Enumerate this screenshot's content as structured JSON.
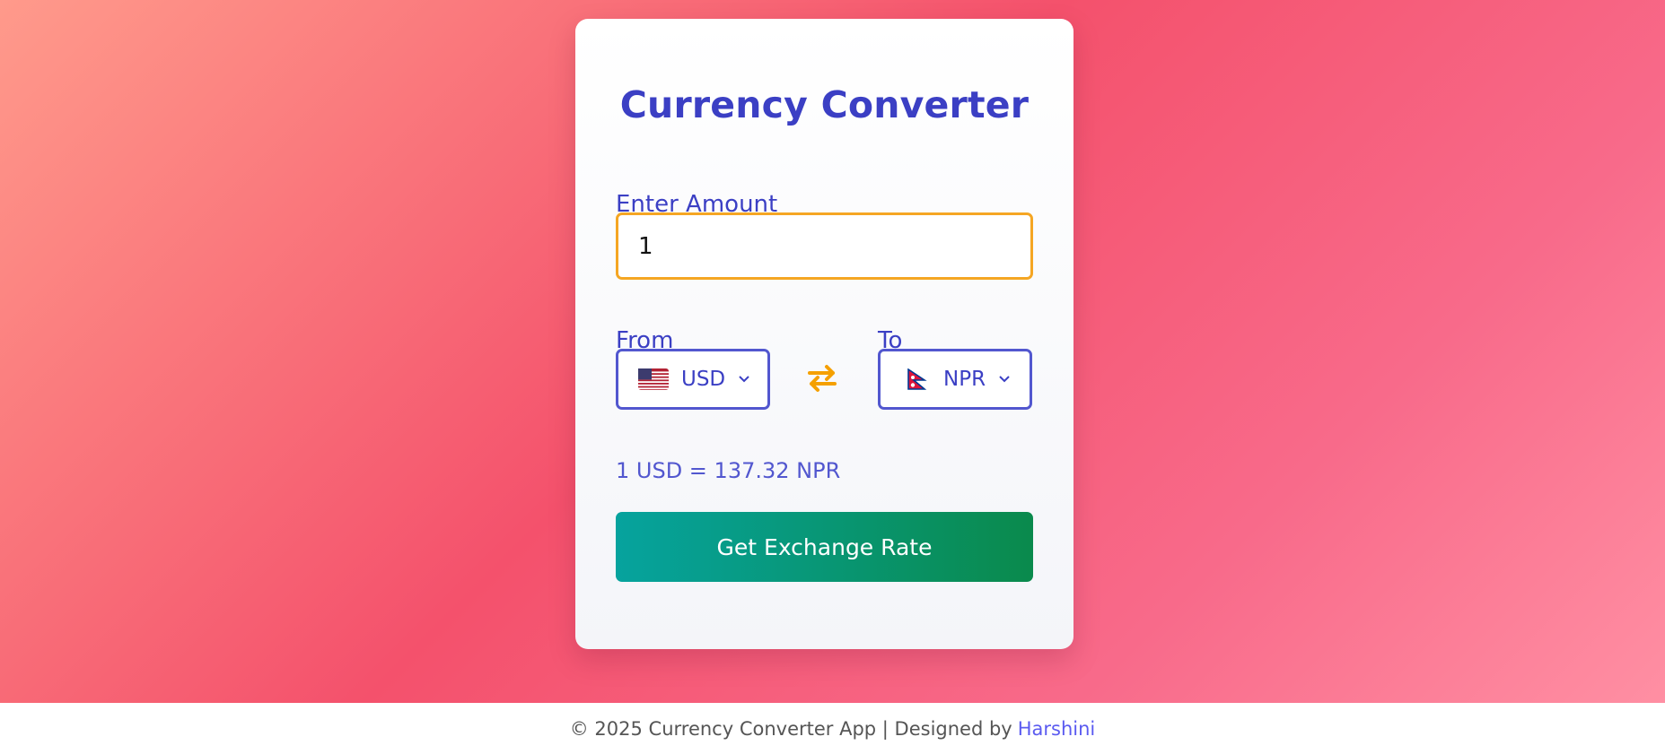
{
  "app": {
    "title": "Currency Converter"
  },
  "form": {
    "amount_label": "Enter Amount",
    "amount_value": "1",
    "from_label": "From",
    "to_label": "To",
    "from_currency": "USD",
    "to_currency": "NPR",
    "from_flag_icon": "us-flag-icon",
    "to_flag_icon": "nepal-flag-icon",
    "swap_icon": "swap-arrows-icon",
    "rate_text": "1 USD = 137.32 NPR",
    "button_label": "Get Exchange Rate"
  },
  "footer": {
    "text": "© 2025 Currency Converter App | Designed by",
    "author": "Harshini"
  },
  "colors": {
    "accent": "#3b3fc4",
    "input_border": "#f5a623",
    "select_border": "#5257cf",
    "button_start": "#06a39e",
    "button_end": "#0a8a4c",
    "swap": "#f5a000"
  }
}
